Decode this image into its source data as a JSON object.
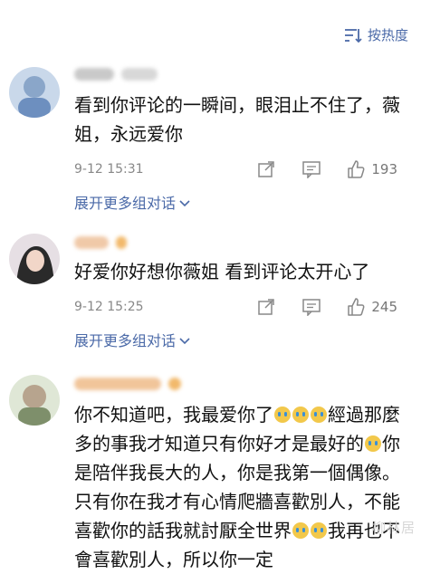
{
  "header": {
    "sort_label": "按热度"
  },
  "comments": [
    {
      "text": "看到你评论的一瞬间，眼泪止不住了，薇姐，永远爱你",
      "time": "9-12 15:31",
      "likes": "193",
      "expand": "展开更多组对话"
    },
    {
      "text": "好爱你好想你薇姐 看到评论太开心了",
      "time": "9-12 15:25",
      "likes": "245",
      "expand": "展开更多组对话"
    },
    {
      "text_part1": "你不知道吧，我最爱你了",
      "text_part2": "經過那麼多的事我才知道只有你好才是最好的",
      "text_part3": "你是陪伴我長大的人，你是我第一個偶像。只有你在我才有心情爬牆喜歡別人，不能喜歡你的話我就討厭全世界",
      "text_part4": "我再也不會喜歡別人，所以你一定"
    }
  ],
  "watermark": "柳林居",
  "colors": {
    "accent": "#4b6aa8",
    "meta": "#888888"
  }
}
